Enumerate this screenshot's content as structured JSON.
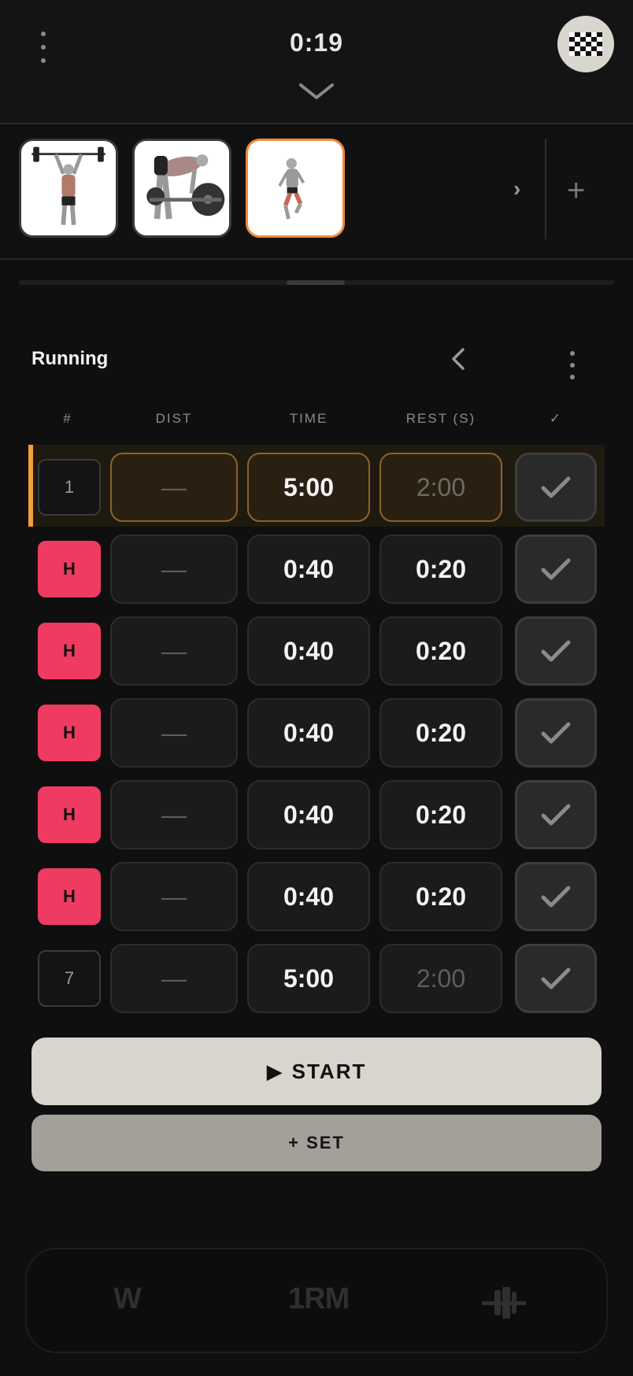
{
  "header": {
    "timer": "0:19"
  },
  "exercises": [
    {
      "name": "Overhead press",
      "active": false
    },
    {
      "name": "Bent-over row",
      "active": false
    },
    {
      "name": "Running",
      "active": true
    }
  ],
  "strip": {
    "next": "›",
    "add": "+"
  },
  "exercise": {
    "title": "Running"
  },
  "table": {
    "columns": [
      "#",
      "DIST",
      "TIME",
      "REST (S)",
      "✓"
    ],
    "rows": [
      {
        "set": "1",
        "type": "normal",
        "dist": "—",
        "time": "5:00",
        "rest": "2:00",
        "rest_muted": true,
        "active": true
      },
      {
        "set": "H",
        "type": "hiit",
        "dist": "—",
        "time": "0:40",
        "rest": "0:20",
        "rest_muted": false,
        "active": false
      },
      {
        "set": "H",
        "type": "hiit",
        "dist": "—",
        "time": "0:40",
        "rest": "0:20",
        "rest_muted": false,
        "active": false
      },
      {
        "set": "H",
        "type": "hiit",
        "dist": "—",
        "time": "0:40",
        "rest": "0:20",
        "rest_muted": false,
        "active": false
      },
      {
        "set": "H",
        "type": "hiit",
        "dist": "—",
        "time": "0:40",
        "rest": "0:20",
        "rest_muted": false,
        "active": false
      },
      {
        "set": "H",
        "type": "hiit",
        "dist": "—",
        "time": "0:40",
        "rest": "0:20",
        "rest_muted": false,
        "active": false
      },
      {
        "set": "7",
        "type": "normal",
        "dist": "—",
        "time": "5:00",
        "rest": "2:00",
        "rest_muted": true,
        "active": false
      }
    ]
  },
  "actions": {
    "start_label": "START",
    "start_icon": "▶",
    "add_set_label": "+ SET"
  },
  "toolbar": {
    "weight_label": "W",
    "onerm_label": "1RM",
    "plates_icon": "barbell-icon"
  },
  "colors": {
    "accent": "#f08a3c",
    "hiit": "#ef3b62",
    "background": "#0f0f0f"
  }
}
